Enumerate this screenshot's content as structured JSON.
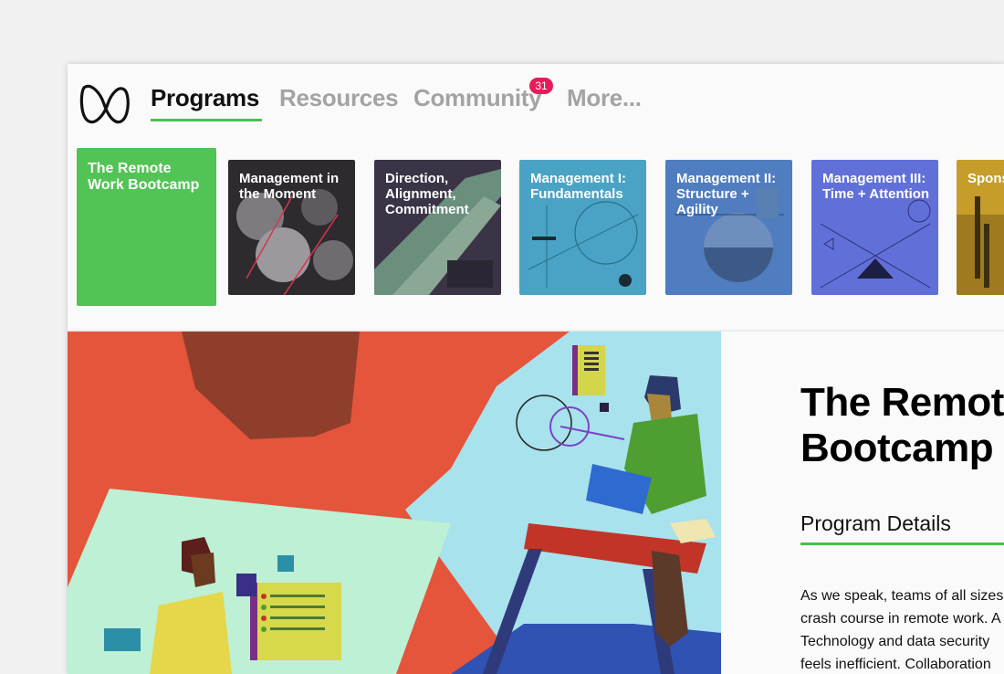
{
  "nav": {
    "tabs": [
      {
        "label": "Programs",
        "active": true
      },
      {
        "label": "Resources",
        "active": false
      },
      {
        "label": "Community",
        "active": false,
        "badge": "31"
      },
      {
        "label": "More...",
        "active": false
      }
    ]
  },
  "programs": [
    {
      "title": "The Remote Work Bootcamp",
      "color": "#52c355",
      "selected": true
    },
    {
      "title": "Management in the Moment",
      "color": "#2d2b2e"
    },
    {
      "title": "Direction, Alignment, Commitment",
      "color": "#3b3447"
    },
    {
      "title": "Management I: Fundamentals",
      "color": "#4aa3c4"
    },
    {
      "title": "Management II: Structure + Agility",
      "color": "#4f7dc0"
    },
    {
      "title": "Management III: Time + Attention",
      "color": "#6170d8"
    },
    {
      "title": "Spons",
      "color": "#c69c2a"
    }
  ],
  "detail": {
    "title_line1": "The Remot",
    "title_line2": "Bootcamp",
    "section_heading": "Program Details",
    "body_lines": [
      "As we speak, teams of all sizes",
      "crash course in remote work. A",
      "Technology and data security",
      "feels inefficient. Collaboration"
    ]
  },
  "colors": {
    "accent": "#4bbf4f",
    "badge": "#e61c5a"
  }
}
